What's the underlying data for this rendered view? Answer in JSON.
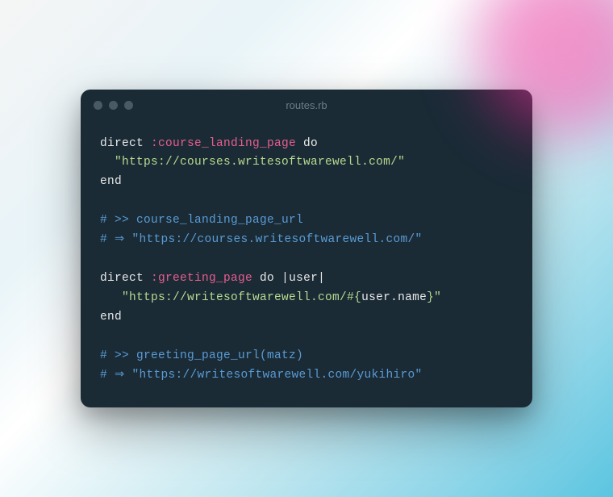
{
  "window": {
    "title": "routes.rb"
  },
  "code": {
    "line1": {
      "kw1": "direct",
      "sym": " :course_landing_page",
      "kw2": " do"
    },
    "line2": {
      "indent": "  ",
      "str": "\"https://courses.writesoftwarewell.com/\""
    },
    "line3": {
      "kw": "end"
    },
    "line5": {
      "cmt": "# >> course_landing_page_url"
    },
    "line6": {
      "cmt_start": "# ⇒ ",
      "cmt_str": "\"https://courses.writesoftwarewell.com/\""
    },
    "line8": {
      "kw1": "direct",
      "sym": " :greeting_page",
      "kw2": " do",
      "args": " |user|"
    },
    "line9": {
      "indent": "   ",
      "str1": "\"https://writesoftwarewell.com/#{",
      "expr": "user.name",
      "str2": "}\""
    },
    "line10": {
      "kw": "end"
    },
    "line12": {
      "cmt": "# >> greeting_page_url(matz)"
    },
    "line13": {
      "cmt_start": "# ⇒ ",
      "cmt_str": "\"https://writesoftwarewell.com/yukihiro\""
    }
  }
}
